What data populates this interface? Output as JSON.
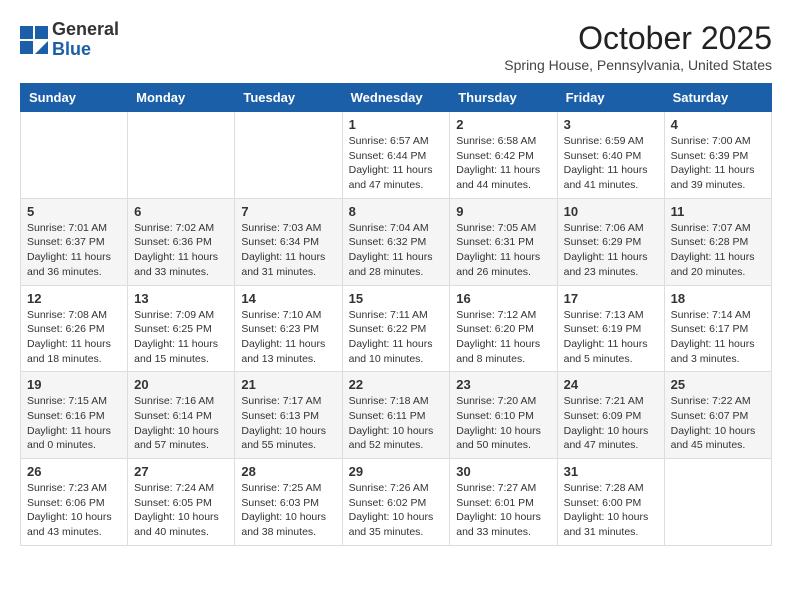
{
  "header": {
    "logo": {
      "line1": "General",
      "line2": "Blue"
    },
    "title": "October 2025",
    "subtitle": "Spring House, Pennsylvania, United States"
  },
  "weekdays": [
    "Sunday",
    "Monday",
    "Tuesday",
    "Wednesday",
    "Thursday",
    "Friday",
    "Saturday"
  ],
  "weeks": [
    [
      {
        "day": "",
        "info": ""
      },
      {
        "day": "",
        "info": ""
      },
      {
        "day": "",
        "info": ""
      },
      {
        "day": "1",
        "info": "Sunrise: 6:57 AM\nSunset: 6:44 PM\nDaylight: 11 hours\nand 47 minutes."
      },
      {
        "day": "2",
        "info": "Sunrise: 6:58 AM\nSunset: 6:42 PM\nDaylight: 11 hours\nand 44 minutes."
      },
      {
        "day": "3",
        "info": "Sunrise: 6:59 AM\nSunset: 6:40 PM\nDaylight: 11 hours\nand 41 minutes."
      },
      {
        "day": "4",
        "info": "Sunrise: 7:00 AM\nSunset: 6:39 PM\nDaylight: 11 hours\nand 39 minutes."
      }
    ],
    [
      {
        "day": "5",
        "info": "Sunrise: 7:01 AM\nSunset: 6:37 PM\nDaylight: 11 hours\nand 36 minutes."
      },
      {
        "day": "6",
        "info": "Sunrise: 7:02 AM\nSunset: 6:36 PM\nDaylight: 11 hours\nand 33 minutes."
      },
      {
        "day": "7",
        "info": "Sunrise: 7:03 AM\nSunset: 6:34 PM\nDaylight: 11 hours\nand 31 minutes."
      },
      {
        "day": "8",
        "info": "Sunrise: 7:04 AM\nSunset: 6:32 PM\nDaylight: 11 hours\nand 28 minutes."
      },
      {
        "day": "9",
        "info": "Sunrise: 7:05 AM\nSunset: 6:31 PM\nDaylight: 11 hours\nand 26 minutes."
      },
      {
        "day": "10",
        "info": "Sunrise: 7:06 AM\nSunset: 6:29 PM\nDaylight: 11 hours\nand 23 minutes."
      },
      {
        "day": "11",
        "info": "Sunrise: 7:07 AM\nSunset: 6:28 PM\nDaylight: 11 hours\nand 20 minutes."
      }
    ],
    [
      {
        "day": "12",
        "info": "Sunrise: 7:08 AM\nSunset: 6:26 PM\nDaylight: 11 hours\nand 18 minutes."
      },
      {
        "day": "13",
        "info": "Sunrise: 7:09 AM\nSunset: 6:25 PM\nDaylight: 11 hours\nand 15 minutes."
      },
      {
        "day": "14",
        "info": "Sunrise: 7:10 AM\nSunset: 6:23 PM\nDaylight: 11 hours\nand 13 minutes."
      },
      {
        "day": "15",
        "info": "Sunrise: 7:11 AM\nSunset: 6:22 PM\nDaylight: 11 hours\nand 10 minutes."
      },
      {
        "day": "16",
        "info": "Sunrise: 7:12 AM\nSunset: 6:20 PM\nDaylight: 11 hours\nand 8 minutes."
      },
      {
        "day": "17",
        "info": "Sunrise: 7:13 AM\nSunset: 6:19 PM\nDaylight: 11 hours\nand 5 minutes."
      },
      {
        "day": "18",
        "info": "Sunrise: 7:14 AM\nSunset: 6:17 PM\nDaylight: 11 hours\nand 3 minutes."
      }
    ],
    [
      {
        "day": "19",
        "info": "Sunrise: 7:15 AM\nSunset: 6:16 PM\nDaylight: 11 hours\nand 0 minutes."
      },
      {
        "day": "20",
        "info": "Sunrise: 7:16 AM\nSunset: 6:14 PM\nDaylight: 10 hours\nand 57 minutes."
      },
      {
        "day": "21",
        "info": "Sunrise: 7:17 AM\nSunset: 6:13 PM\nDaylight: 10 hours\nand 55 minutes."
      },
      {
        "day": "22",
        "info": "Sunrise: 7:18 AM\nSunset: 6:11 PM\nDaylight: 10 hours\nand 52 minutes."
      },
      {
        "day": "23",
        "info": "Sunrise: 7:20 AM\nSunset: 6:10 PM\nDaylight: 10 hours\nand 50 minutes."
      },
      {
        "day": "24",
        "info": "Sunrise: 7:21 AM\nSunset: 6:09 PM\nDaylight: 10 hours\nand 47 minutes."
      },
      {
        "day": "25",
        "info": "Sunrise: 7:22 AM\nSunset: 6:07 PM\nDaylight: 10 hours\nand 45 minutes."
      }
    ],
    [
      {
        "day": "26",
        "info": "Sunrise: 7:23 AM\nSunset: 6:06 PM\nDaylight: 10 hours\nand 43 minutes."
      },
      {
        "day": "27",
        "info": "Sunrise: 7:24 AM\nSunset: 6:05 PM\nDaylight: 10 hours\nand 40 minutes."
      },
      {
        "day": "28",
        "info": "Sunrise: 7:25 AM\nSunset: 6:03 PM\nDaylight: 10 hours\nand 38 minutes."
      },
      {
        "day": "29",
        "info": "Sunrise: 7:26 AM\nSunset: 6:02 PM\nDaylight: 10 hours\nand 35 minutes."
      },
      {
        "day": "30",
        "info": "Sunrise: 7:27 AM\nSunset: 6:01 PM\nDaylight: 10 hours\nand 33 minutes."
      },
      {
        "day": "31",
        "info": "Sunrise: 7:28 AM\nSunset: 6:00 PM\nDaylight: 10 hours\nand 31 minutes."
      },
      {
        "day": "",
        "info": ""
      }
    ]
  ]
}
